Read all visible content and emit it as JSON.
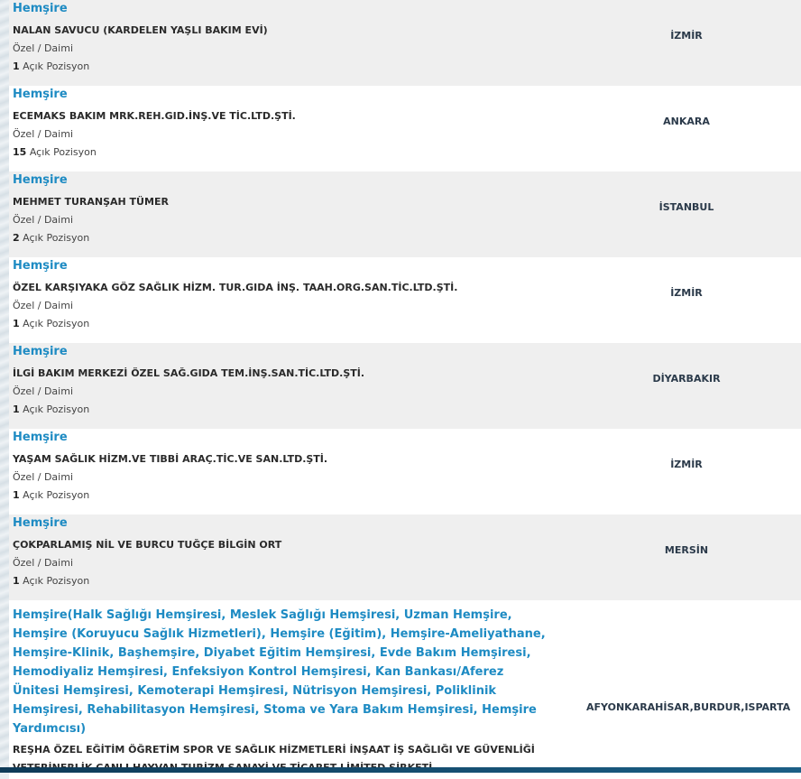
{
  "jobs": [
    {
      "title": "Hemşire",
      "company": "NALAN SAVUCU (KARDELEN YAŞLI BAKIM EVİ)",
      "type": "Özel / Daimi",
      "count": "1",
      "positions_label": "Açık Pozisyon",
      "city": "İZMİR"
    },
    {
      "title": "Hemşire",
      "company": "ECEMAKS BAKIM MRK.REH.GID.İNŞ.VE TİC.LTD.ŞTİ.",
      "type": "Özel / Daimi",
      "count": "15",
      "positions_label": "Açık Pozisyon",
      "city": "ANKARA"
    },
    {
      "title": "Hemşire",
      "company": "MEHMET TURANŞAH TÜMER",
      "type": "Özel / Daimi",
      "count": "2",
      "positions_label": "Açık Pozisyon",
      "city": "İSTANBUL"
    },
    {
      "title": "Hemşire",
      "company": "ÖZEL KARŞIYAKA GÖZ SAĞLIK HİZM. TUR.GIDA İNŞ. TAAH.ORG.SAN.TİC.LTD.ŞTİ.",
      "type": "Özel / Daimi",
      "count": "1",
      "positions_label": "Açık Pozisyon",
      "city": "İZMİR"
    },
    {
      "title": "Hemşire",
      "company": "İLGİ BAKIM MERKEZİ ÖZEL SAĞ.GIDA TEM.İNŞ.SAN.TİC.LTD.ŞTİ.",
      "type": "Özel / Daimi",
      "count": "1",
      "positions_label": "Açık Pozisyon",
      "city": "DİYARBAKIR"
    },
    {
      "title": "Hemşire",
      "company": "YAŞAM SAĞLIK HİZM.VE TIBBİ ARAÇ.TİC.VE SAN.LTD.ŞTİ.",
      "type": "Özel / Daimi",
      "count": "1",
      "positions_label": "Açık Pozisyon",
      "city": "İZMİR"
    },
    {
      "title": "Hemşire",
      "company": "ÇOKPARLAMIŞ NİL VE BURCU TUĞÇE BİLGİN ORT",
      "type": "Özel / Daimi",
      "count": "1",
      "positions_label": "Açık Pozisyon",
      "city": "MERSİN"
    },
    {
      "title": "Hemşire(Halk Sağlığı Hemşiresi, Meslek Sağlığı Hemşiresi, Uzman Hemşire, Hemşire (Koruyucu Sağlık Hizmetleri), Hemşire (Eğitim), Hemşire-Ameliyathane, Hemşire-Klinik, Başhemşire, Diyabet Eğitim Hemşiresi, Evde Bakım Hemşiresi, Hemodiyaliz Hemşiresi, Enfeksiyon Kontrol Hemşiresi, Kan Bankası/Aferez Ünitesi Hemşiresi, Kemoterapi Hemşiresi, Nütrisyon Hemşiresi, Poliklinik Hemşiresi, Rehabilitasyon Hemşiresi, Stoma ve Yara Bakım Hemşiresi, Hemşire Yardımcısı)",
      "company": "REŞHA ÖZEL EĞİTİM ÖĞRETİM SPOR VE SAĞLIK HİZMETLERİ İNŞAAT İŞ SAĞLIĞI VE GÜVENLİĞİ VETERİNERLİK CANLI HAYVAN TURİZM SANAYİ VE TİCARET LİMİTED ŞİRKETİ",
      "city": "AFYONKARAHİSAR,BURDUR,ISPARTA"
    }
  ]
}
